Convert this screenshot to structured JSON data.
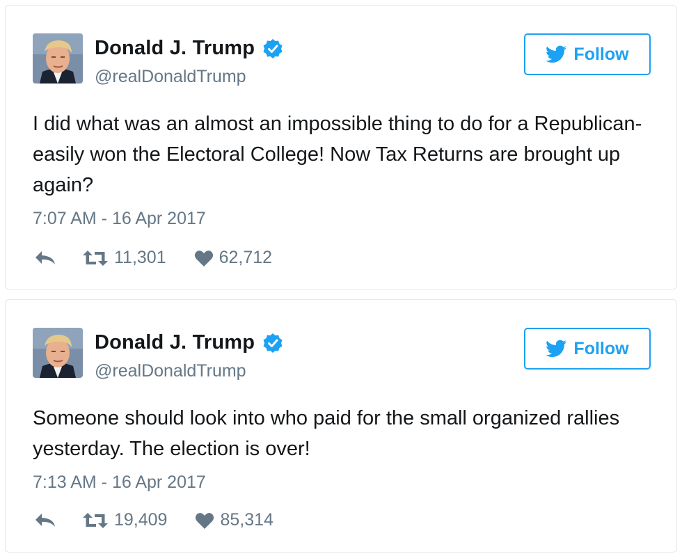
{
  "tweets": [
    {
      "display_name": "Donald J. Trump",
      "handle": "@realDonaldTrump",
      "follow_label": "Follow",
      "text": "I did what was an almost an impossible thing to do for a Republican-easily won the Electoral College! Now Tax Returns are brought up again?",
      "timestamp": "7:07 AM - 16 Apr 2017",
      "retweets": "11,301",
      "likes": "62,712"
    },
    {
      "display_name": "Donald J. Trump",
      "handle": "@realDonaldTrump",
      "follow_label": "Follow",
      "text": "Someone should look into who paid for the small organized rallies yesterday. The election is over!",
      "timestamp": "7:13 AM - 16 Apr 2017",
      "retweets": "19,409",
      "likes": "85,314"
    }
  ],
  "colors": {
    "accent": "#1da1f2",
    "text": "#14171a",
    "muted": "#657786",
    "border": "#e1e8ed"
  },
  "icons": [
    "verified-badge-icon",
    "twitter-bird-icon",
    "reply-icon",
    "retweet-icon",
    "heart-icon"
  ]
}
